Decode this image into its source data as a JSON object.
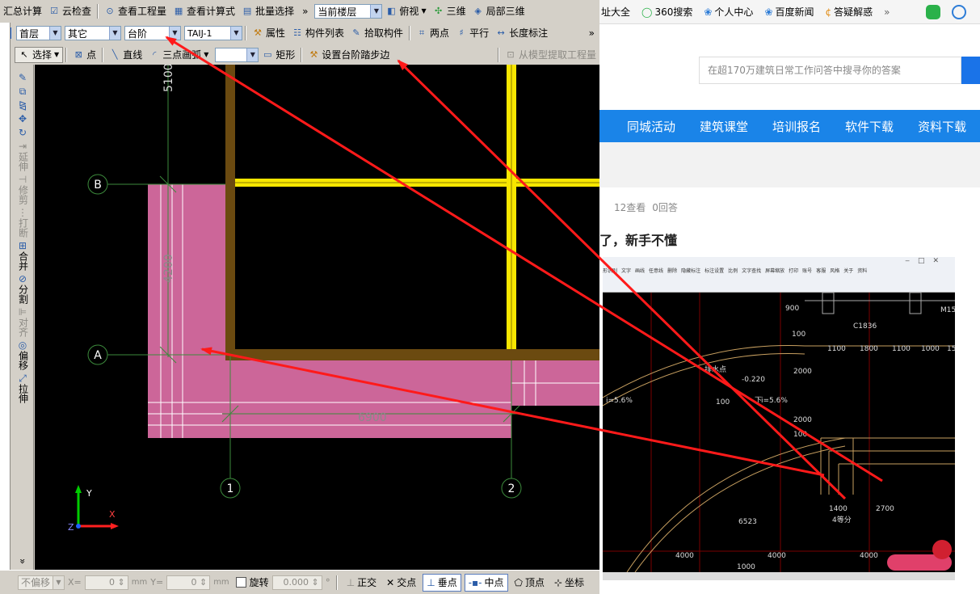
{
  "toolbar1": {
    "items": [
      "汇总计算",
      "云检查",
      "查看工程量",
      "查看计算式",
      "批量选择"
    ],
    "more": "»",
    "floor_label": "当前楼层",
    "view_items": [
      "俯视",
      "三维",
      "局部三维"
    ]
  },
  "toolbar2": {
    "floor": "首层",
    "category": "其它",
    "component": "台阶",
    "instance": "TAIJ-1",
    "items": [
      "属性",
      "构件列表",
      "拾取构件"
    ],
    "draw_items": [
      "两点",
      "平行",
      "长度标注"
    ],
    "more": "»"
  },
  "toolbar3": {
    "select": "选择",
    "items": [
      "点",
      "直线",
      "三点画弧"
    ],
    "rect": "矩形",
    "set_step": "设置台阶踏步边",
    "extract": "从模型提取工程量"
  },
  "vertical_tools": [
    "延伸",
    "修剪",
    "打断",
    "合并",
    "分割",
    "对齐",
    "偏移",
    "拉伸"
  ],
  "vertical_more": "»",
  "drawing": {
    "axes": [
      "A",
      "B",
      "1",
      "2"
    ],
    "dims": [
      "5100",
      "4200",
      "6900"
    ],
    "coord_x": "X",
    "coord_y": "Y",
    "coord_z": "Z"
  },
  "status": {
    "offset_mode": "不偏移",
    "x_label": "X=",
    "x_value": "0",
    "y_label": "Y=",
    "y_value": "0",
    "unit": "mm",
    "rotate_label": "旋转",
    "rotate_value": "0.000",
    "degree": "°",
    "snaps": [
      "正交",
      "交点",
      "垂点",
      "中点",
      "顶点",
      "坐标"
    ]
  },
  "browser": {
    "favorites": [
      "址大全",
      "360搜索",
      "个人中心",
      "百度新闻",
      "答疑解惑"
    ],
    "fav_more": "»",
    "search_placeholder": "在超170万建筑日常工作问答中搜寻你的答案",
    "nav": [
      "同城活动",
      "建筑课堂",
      "培训报名",
      "软件下载",
      "资料下载"
    ],
    "views": "12查看",
    "answers": "0回答",
    "question_title": "了，新手不懂"
  },
  "embedded": {
    "toolbar": [
      "形识别",
      "文字",
      "画线",
      "任意线",
      "删除",
      "隐藏标注",
      "标注设置",
      "比例",
      "文字查找",
      "屏幕缩放",
      "打印",
      "账号",
      "客服",
      "风格",
      "关于",
      "资料"
    ],
    "dims": [
      "900",
      "100",
      "2000",
      "2000",
      "100",
      "1100",
      "1800",
      "1100",
      "1000",
      "15",
      "-0.220",
      "100",
      "1400",
      "2700",
      "6523",
      "4000",
      "4000",
      "4000",
      "1000"
    ],
    "labels": [
      "C1836",
      "M15",
      "i=5.6%",
      "i=5.6%",
      "4等分",
      "排水点",
      "下"
    ]
  },
  "colors": {
    "arrow": "#ff1a1a",
    "slab": "#cc6699",
    "beam": "#f7e600",
    "wall": "#6b4a10",
    "nav": "#1a84e8"
  }
}
